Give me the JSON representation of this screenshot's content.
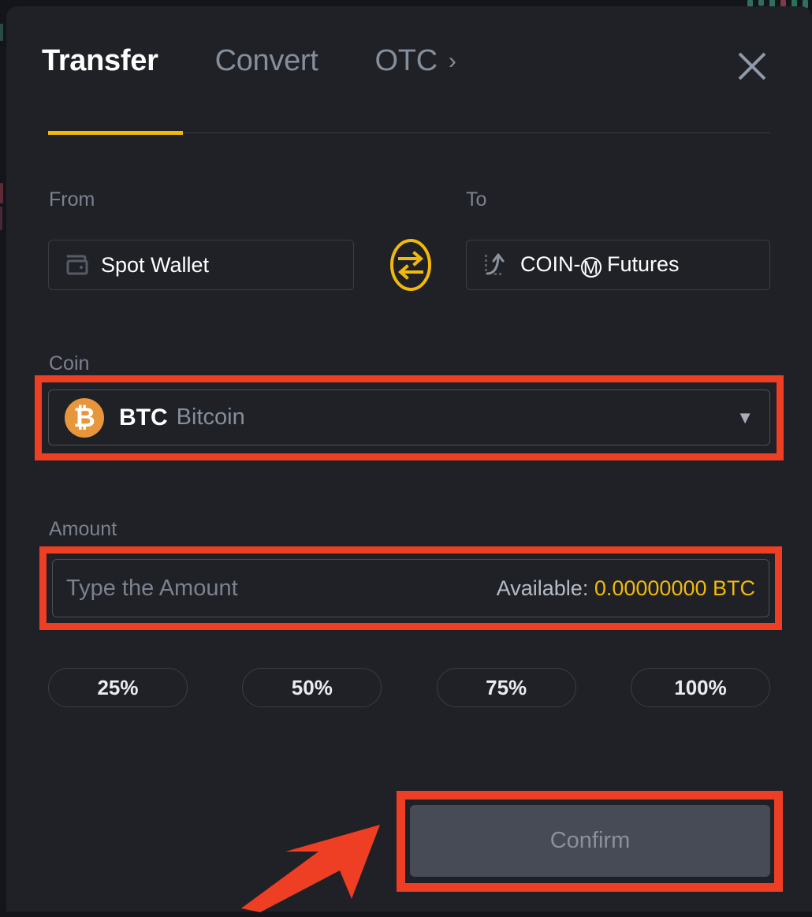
{
  "colors": {
    "modal_bg": "#202126",
    "page_bg": "#14151a",
    "accent_yellow": "#f0b90b",
    "highlight_red": "#ee3e23",
    "btc_orange": "#e8963c",
    "muted_text": "#848e9c",
    "confirm_fill": "#474b55"
  },
  "header": {
    "tabs": [
      {
        "label": "Transfer",
        "state": "active"
      },
      {
        "label": "Convert",
        "state": "inactive"
      },
      {
        "label": "OTC",
        "state": "inactive"
      }
    ],
    "otc_chevron_icon": "chevron-right-icon",
    "close_icon": "close-icon"
  },
  "transfer": {
    "from": {
      "label": "From",
      "value": "Spot Wallet",
      "icon": "wallet-icon"
    },
    "to": {
      "label": "To",
      "value_prefix": "COIN-",
      "value_badge": "M",
      "value_suffix": "Futures",
      "icon": "futures-trend-icon"
    },
    "swap_icon": "swap-arrows-icon",
    "coin": {
      "label": "Coin",
      "symbol": "BTC",
      "name": "Bitcoin",
      "icon": "bitcoin-icon",
      "icon_glyph": "₿",
      "caret_icon": "caret-down-icon"
    },
    "amount": {
      "label": "Amount",
      "value": "",
      "placeholder": "Type the Amount",
      "available_label": "Available:",
      "available_value": "0.00000000 BTC"
    },
    "percent_buttons": [
      {
        "label": "25%"
      },
      {
        "label": "50%"
      },
      {
        "label": "75%"
      },
      {
        "label": "100%"
      }
    ],
    "confirm_label": "Confirm"
  },
  "annotations": {
    "arrow_icon": "pointer-arrow-icon",
    "highlight_boxes": [
      "coin-selector",
      "amount-field",
      "confirm-button"
    ]
  }
}
